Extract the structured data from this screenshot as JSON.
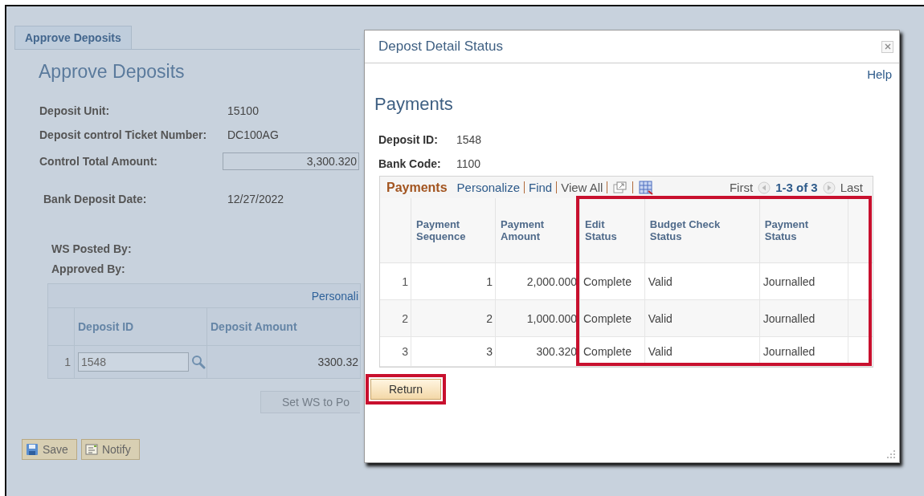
{
  "background_page": {
    "tab": {
      "label": "Approve Deposits",
      "selected": true
    },
    "title": "Approve Deposits",
    "fields": [
      {
        "label": "Deposit Unit:",
        "value": "15100",
        "kind": "text"
      },
      {
        "label": "Deposit control Ticket Number:",
        "value": "DC100AG",
        "kind": "text"
      },
      {
        "label": "Control Total Amount:",
        "value": "3,300.320",
        "kind": "input"
      },
      {
        "label": "Bank Deposit Date:",
        "value": "12/27/2022",
        "kind": "text"
      }
    ],
    "approval_labels": [
      "WS Posted By:",
      "Approved By:"
    ],
    "grid": {
      "toolbar_link": "Personali",
      "columns": [
        "Deposit ID",
        "Deposit Amount"
      ],
      "rows": [
        {
          "row_number": "1",
          "deposit_id": "1548",
          "deposit_amount": "3300.32"
        }
      ]
    },
    "set_button": {
      "label": "Set WS to Po",
      "disabled": true
    },
    "buttons": [
      {
        "label": "Save"
      },
      {
        "label": "Notify"
      }
    ]
  },
  "modal": {
    "title": "Depost Detail Status",
    "help_link": "Help",
    "heading": "Payments",
    "fields": [
      {
        "label": "Deposit ID:",
        "value": "1548"
      },
      {
        "label": "Bank Code:",
        "value": "1100"
      }
    ],
    "grid": {
      "title": "Payments",
      "links": [
        "Personalize",
        "Find",
        "View All"
      ],
      "pagination": {
        "first": "First",
        "range": "1-3 of 3",
        "last": "Last"
      },
      "columns": [
        {
          "label": "Payment Sequence",
          "kind": "number",
          "highlighted": false
        },
        {
          "label": "Payment Amount",
          "kind": "number",
          "highlighted": false
        },
        {
          "label": "Edit Status",
          "kind": "text",
          "highlighted": true
        },
        {
          "label": "Budget Check Status",
          "kind": "text",
          "highlighted": true
        },
        {
          "label": "Payment Status",
          "kind": "text",
          "highlighted": true
        }
      ],
      "rows": [
        {
          "row_number": "1",
          "cells": [
            "1",
            "2,000.000",
            "Complete",
            "Valid",
            "Journalled"
          ]
        },
        {
          "row_number": "2",
          "cells": [
            "2",
            "1,000.000",
            "Complete",
            "Valid",
            "Journalled"
          ]
        },
        {
          "row_number": "3",
          "cells": [
            "3",
            "300.320",
            "Complete",
            "Valid",
            "Journalled"
          ]
        }
      ]
    },
    "return_button": {
      "label": "Return",
      "highlighted": true
    }
  }
}
